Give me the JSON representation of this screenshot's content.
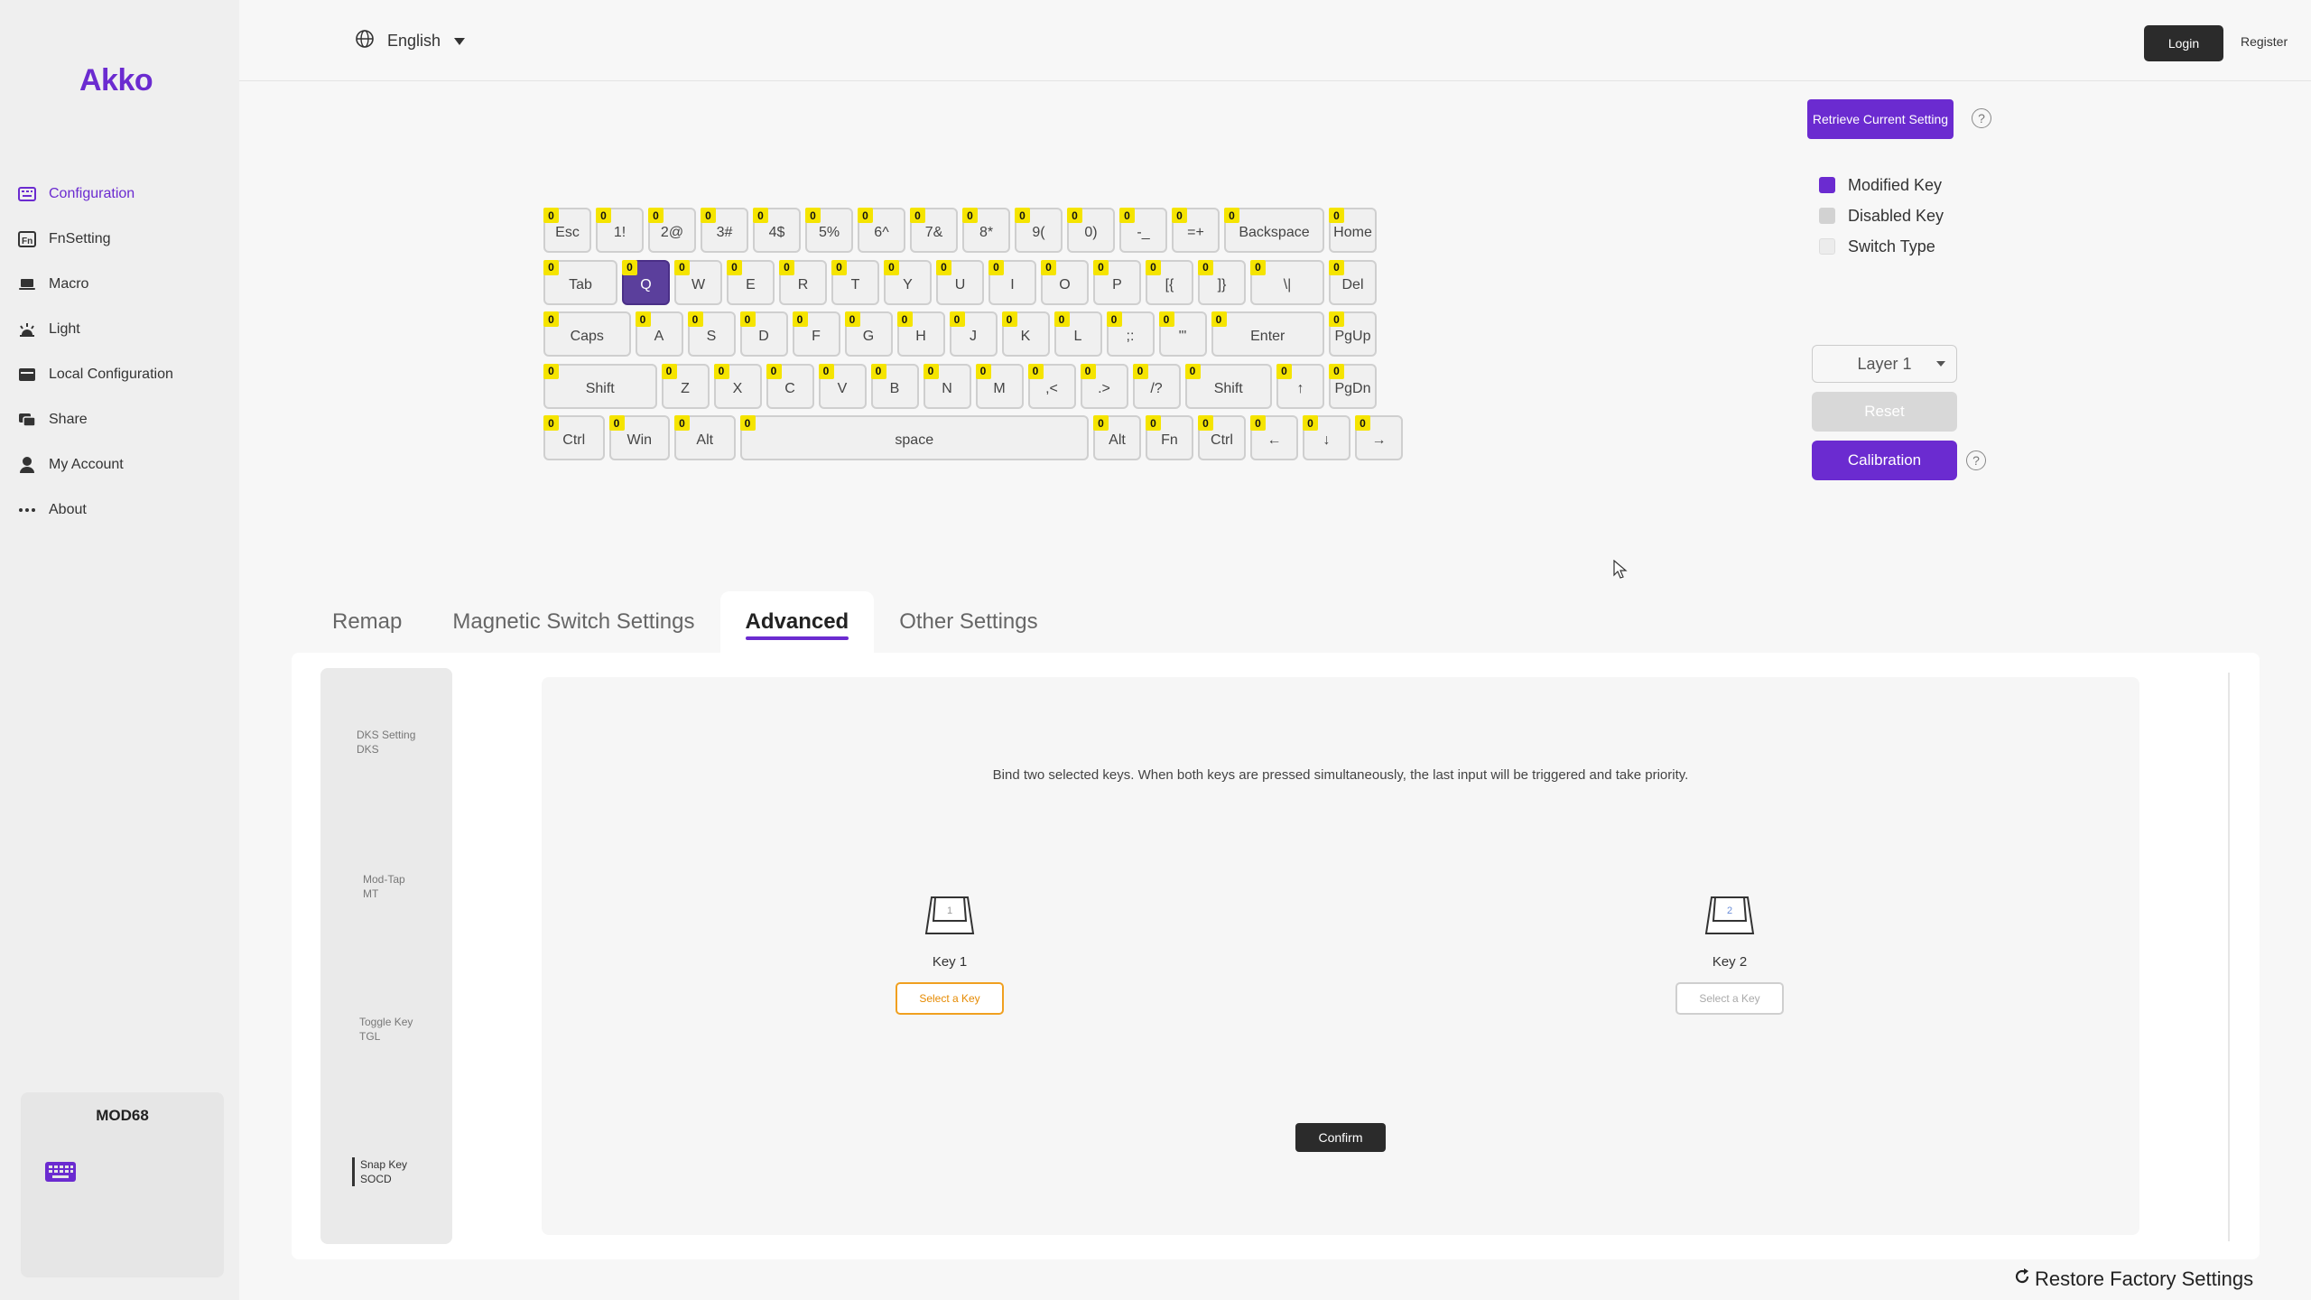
{
  "app": {
    "logo": "Akko"
  },
  "sidebar": {
    "items": [
      {
        "label": "Configuration",
        "icon": "keyboard-icon",
        "active": true
      },
      {
        "label": "FnSetting",
        "icon": "fn-icon"
      },
      {
        "label": "Macro",
        "icon": "laptop-icon"
      },
      {
        "label": "Light",
        "icon": "light-icon"
      },
      {
        "label": "Local Configuration",
        "icon": "folder-icon"
      },
      {
        "label": "Share",
        "icon": "share-icon"
      },
      {
        "label": "My Account",
        "icon": "user-icon"
      },
      {
        "label": "About",
        "icon": "more-icon"
      }
    ],
    "device": {
      "name": "MOD68"
    }
  },
  "header": {
    "language": "English",
    "login": "Login",
    "register": "Register"
  },
  "keyboard": {
    "badge": "0",
    "rows": [
      [
        "Esc",
        "1!",
        "2@",
        "3#",
        "4$",
        "5%",
        "6^",
        "7&",
        "8*",
        "9(",
        "0)",
        "-_",
        "=+",
        "Backspace",
        "Home"
      ],
      [
        "Tab",
        "Q",
        "W",
        "E",
        "R",
        "T",
        "Y",
        "U",
        "I",
        "O",
        "P",
        "[{",
        "]}",
        "\\|",
        "Del"
      ],
      [
        "Caps",
        "A",
        "S",
        "D",
        "F",
        "G",
        "H",
        "J",
        "K",
        "L",
        ";:",
        "'\"",
        "Enter",
        "PgUp"
      ],
      [
        "Shift",
        "Z",
        "X",
        "C",
        "V",
        "B",
        "N",
        "M",
        ",<",
        ".>",
        "/?",
        "Shift",
        "↑",
        "PgDn"
      ],
      [
        "Ctrl",
        "Win",
        "Alt",
        "space",
        "Alt",
        "Fn",
        "Ctrl",
        "←",
        "↓",
        "→"
      ]
    ],
    "selected": "Q"
  },
  "right_panel": {
    "retrieve": "Retrieve Current Setting",
    "legend": [
      {
        "label": "Modified Key",
        "color": "#6b2bd0"
      },
      {
        "label": "Disabled Key",
        "color": "#d2d2d2"
      },
      {
        "label": "Switch Type",
        "color": "#ececec"
      }
    ],
    "layer": "Layer 1",
    "reset": "Reset",
    "calibration": "Calibration",
    "help": "?"
  },
  "tabs": [
    {
      "label": "Remap"
    },
    {
      "label": "Magnetic Switch Settings"
    },
    {
      "label": "Advanced",
      "active": true
    },
    {
      "label": "Other Settings"
    }
  ],
  "advanced": {
    "subnav": [
      {
        "title": "DKS Setting",
        "code": "DKS"
      },
      {
        "title": "Mod-Tap",
        "code": "MT"
      },
      {
        "title": "Toggle Key",
        "code": "TGL"
      },
      {
        "title": "Snap Key",
        "code": "SOCD",
        "active": true
      }
    ],
    "description": "Bind two selected keys. When both keys are pressed simultaneously, the last input will be triggered and take priority.",
    "key1": {
      "label": "Key 1",
      "number": "1",
      "button": "Select a Key"
    },
    "key2": {
      "label": "Key 2",
      "number": "2",
      "button": "Select a Key"
    },
    "confirm": "Confirm"
  },
  "footer": {
    "restore": "Restore Factory Settings"
  }
}
